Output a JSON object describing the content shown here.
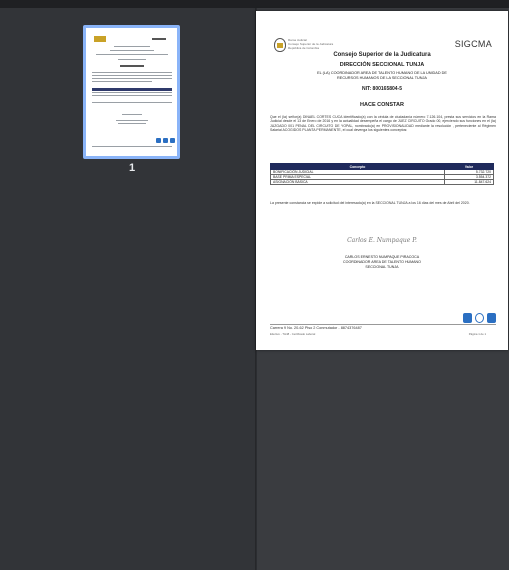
{
  "thumbnails": [
    {
      "page_number": "1",
      "selected": true
    }
  ],
  "page": {
    "logo_text": [
      "Rama Judicial",
      "Consejo Superior de la Judicatura",
      "República de Colombia"
    ],
    "system": "SIGCMA",
    "council": "Consejo Superior de la Judicatura",
    "direction": "DIRECCIÓN SECCIONAL TUNJA",
    "coordinator_line": "EL (LA) COORDINADOR AREA DE TALENTO HUMANO DE LA UNIDAD DE RECURSOS HUMANOS DE LA SECCIONAL TUNJA",
    "nit": "NIT: 800165804-5",
    "heading": "HACE CONSTAR",
    "paragraph": "Que el (la) señor(a) DINAEL  CORTES CUCA identificado(a) con la cédula de ciudadanía número 7.126.104, presta sus servicios en la Rama Judicial desde el 13 de Enero de 2016 y en la actualidad desempeña el cargo de JUEZ CIRCUITO Grado 00, ejerciendo sus funciones en el (la) JUZGADO 001 PENAL DEL CIRCUITO DE YOPAL, nombrado(a) en PROVISIONALIDAD mediante la resolución , perteneciente al Régimen Salarial ACOGIDOS PLANTA PERMANENTE, el cual devenga los siguientes conceptos:",
    "table": {
      "headers": [
        "Concepto",
        "Valor"
      ],
      "rows": [
        [
          "BONIFICACIÓN JUDICIAL",
          "5.732.720"
        ],
        [
          "BASE PRIMA ESPECIAL",
          "3.554.372"
        ],
        [
          "ASIGNACIÓN BÁSICA",
          "11.847.624"
        ]
      ]
    },
    "closing": "La presente constancia se expide a solicitud del interesado(a) en la SECCIONAL TUNJA a los 16 días del mes de Abril del 2020.",
    "signature": "Carlos E. Numpaque P.",
    "signer_name": "CARLOS ERNESTO NUMPAQUE PIRACOCA",
    "signer_title": "COORDINADOR AREA DE TALENTO HUMANO",
    "signer_office": "SECCIONAL TUNJA",
    "footer_address": "Carrera 9 No. 20-62 Piso 2    Conmutador - 8874376487",
    "footer_left": "Efectivo - TH48 - Certificado Laboral",
    "footer_right": "Página 1 de 1"
  },
  "colors": {
    "accent": "#8ab4f8",
    "table_header": "#1f2a5c",
    "icon_blue": "#2b6fc2"
  }
}
